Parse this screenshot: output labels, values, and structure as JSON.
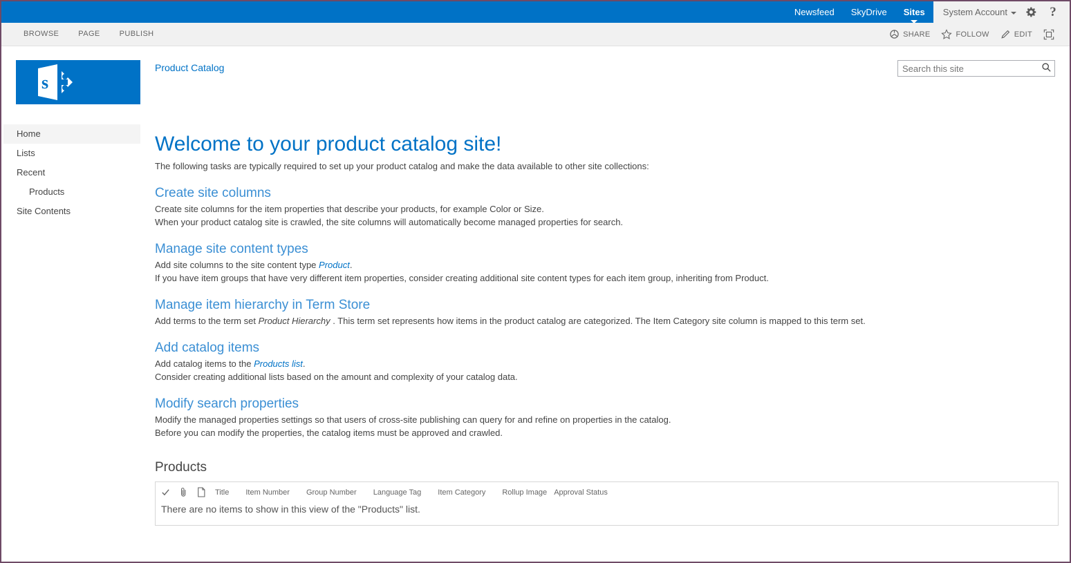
{
  "suite": {
    "links": [
      {
        "label": "Newsfeed",
        "selected": false
      },
      {
        "label": "SkyDrive",
        "selected": false
      },
      {
        "label": "Sites",
        "selected": true
      }
    ],
    "account": "System Account",
    "settings_icon": "gear-icon",
    "help_icon": "help-icon",
    "help_glyph": "?"
  },
  "ribbon": {
    "tabs": [
      {
        "label": "BROWSE"
      },
      {
        "label": "PAGE"
      },
      {
        "label": "PUBLISH"
      }
    ],
    "actions": [
      {
        "label": "SHARE",
        "icon": "share-icon"
      },
      {
        "label": "FOLLOW",
        "icon": "star-icon"
      },
      {
        "label": "EDIT",
        "icon": "pencil-icon"
      }
    ],
    "focus_label": "focus-on-content-icon"
  },
  "header": {
    "logo_alt": "sharepoint-logo",
    "site_title": "Product Catalog"
  },
  "search": {
    "placeholder": "Search this site",
    "value": "",
    "icon": "search-icon"
  },
  "sidebar": {
    "items": [
      {
        "label": "Home",
        "selected": true,
        "child": false
      },
      {
        "label": "Lists",
        "selected": false,
        "child": false
      },
      {
        "label": "Recent",
        "selected": false,
        "child": false
      },
      {
        "label": "Products",
        "selected": false,
        "child": true
      },
      {
        "label": "Site Contents",
        "selected": false,
        "child": false
      }
    ]
  },
  "main": {
    "welcome_heading": "Welcome to your product catalog site!",
    "intro": "The following tasks are typically required to set up your product catalog and make the data available to other site collections:",
    "tasks": [
      {
        "title": "Create site columns",
        "line1_pre": "Create site columns for the item properties that describe your products, for example Color or Size.",
        "line1_link": "",
        "line1_post": "",
        "line2": "When your product catalog site is crawled, the site columns will automatically become managed properties for search."
      },
      {
        "title": "Manage site content types",
        "line1_pre": "Add site columns to the site content type ",
        "line1_link": "Product",
        "line1_post": ".",
        "line2": "If you have item groups that have very different item properties, consider creating additional site content types for each item group, inheriting from Product."
      },
      {
        "title": "Manage item hierarchy in Term Store",
        "line1_pre": "Add terms to the term set ",
        "line1_em": "Product Hierarchy",
        "line1_post": " . This term set represents how items in the product catalog are categorized. The Item Category site column is mapped to this term set.",
        "line2": ""
      },
      {
        "title": "Add catalog items",
        "line1_pre": "Add catalog items to the ",
        "line1_link": "Products list",
        "line1_post": ".",
        "line2": "Consider creating additional lists based on the amount and complexity of your catalog data."
      },
      {
        "title": "Modify search properties",
        "line1_pre": "Modify the managed properties settings so that users of cross-site publishing can query for and refine on properties in the catalog.",
        "line1_link": "",
        "line1_post": "",
        "line2": "Before you can modify the properties, the catalog items must be approved and crawled."
      }
    ]
  },
  "webpart": {
    "title": "Products",
    "icon_columns": [
      {
        "name": "check-icon"
      },
      {
        "name": "paperclip-icon"
      },
      {
        "name": "document-icon"
      }
    ],
    "columns": [
      "Title",
      "Item Number",
      "Group Number",
      "Language Tag",
      "Item Category",
      "Rollup Image",
      "Approval Status"
    ],
    "empty_message": "There are no items to show in this view of the \"Products\" list."
  },
  "colors": {
    "suite_blue": "#0072c6",
    "link_blue": "#0072c6",
    "heading_blue": "#3b8fd4",
    "page_border": "#6e4a66",
    "nav_selected": "#f4f4f4"
  }
}
